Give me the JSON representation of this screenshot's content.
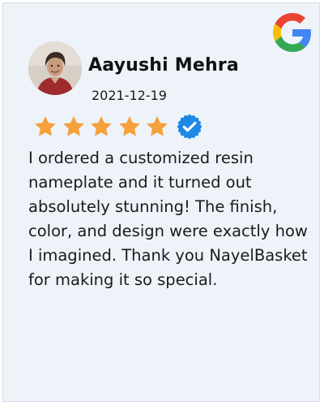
{
  "reviewer": {
    "name": "Aayushi Mehra",
    "date": "2021-12-19",
    "avatar_icon": "reviewer-avatar-photo"
  },
  "rating": {
    "value": 5,
    "max": 5,
    "star_color": "#f5a23c"
  },
  "badge": {
    "icon": "verified-check-icon",
    "color": "#1e88e5"
  },
  "brand": {
    "icon": "google-g-logo"
  },
  "review": {
    "text": "I ordered a customized resin nameplate and it turned out absolutely stunning! The finish, color, and design were exactly how I imagined. Thank you NayelBasket for making it so special."
  },
  "colors": {
    "background": "#eef3fa",
    "text": "#1a1a1a"
  }
}
